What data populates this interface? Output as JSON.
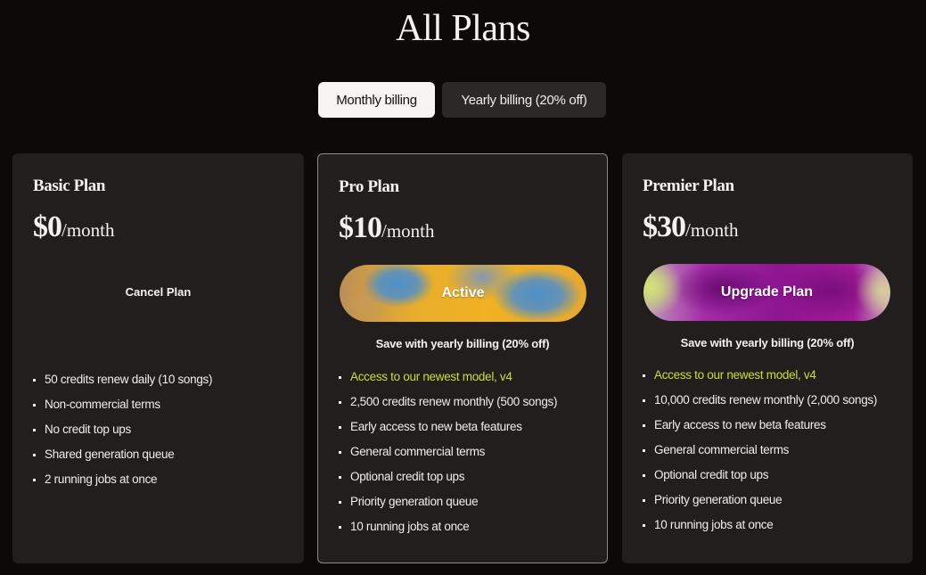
{
  "page": {
    "title": "All Plans"
  },
  "billing": {
    "monthly_label": "Monthly billing",
    "yearly_label": "Yearly billing (20% off)",
    "selected": "monthly"
  },
  "plans": [
    {
      "name": "Basic Plan",
      "price": "$0",
      "period": "/month",
      "action_label": "Cancel Plan",
      "features": [
        "50 credits renew daily (10 songs)",
        "Non-commercial terms",
        "No credit top ups",
        "Shared generation queue",
        "2 running jobs at once"
      ]
    },
    {
      "name": "Pro Plan",
      "price": "$10",
      "period": "/month",
      "action_label": "Active",
      "save_note": "Save with yearly billing (20% off)",
      "highlight": "Access to our newest model, v4",
      "features": [
        "2,500 credits renew monthly (500 songs)",
        "Early access to new beta features",
        "General commercial terms",
        "Optional credit top ups",
        "Priority generation queue",
        "10 running jobs at once"
      ]
    },
    {
      "name": "Premier Plan",
      "price": "$30",
      "period": "/month",
      "action_label": "Upgrade Plan",
      "save_note": "Save with yearly billing (20% off)",
      "highlight": "Access to our newest model, v4",
      "features": [
        "10,000 credits renew monthly (2,000 songs)",
        "Early access to new beta features",
        "General commercial terms",
        "Optional credit top ups",
        "Priority generation queue",
        "10 running jobs at once"
      ]
    }
  ],
  "colors": {
    "background": "#0d0908",
    "card": "#211e1d",
    "highlight_text": "#c9df3a"
  }
}
